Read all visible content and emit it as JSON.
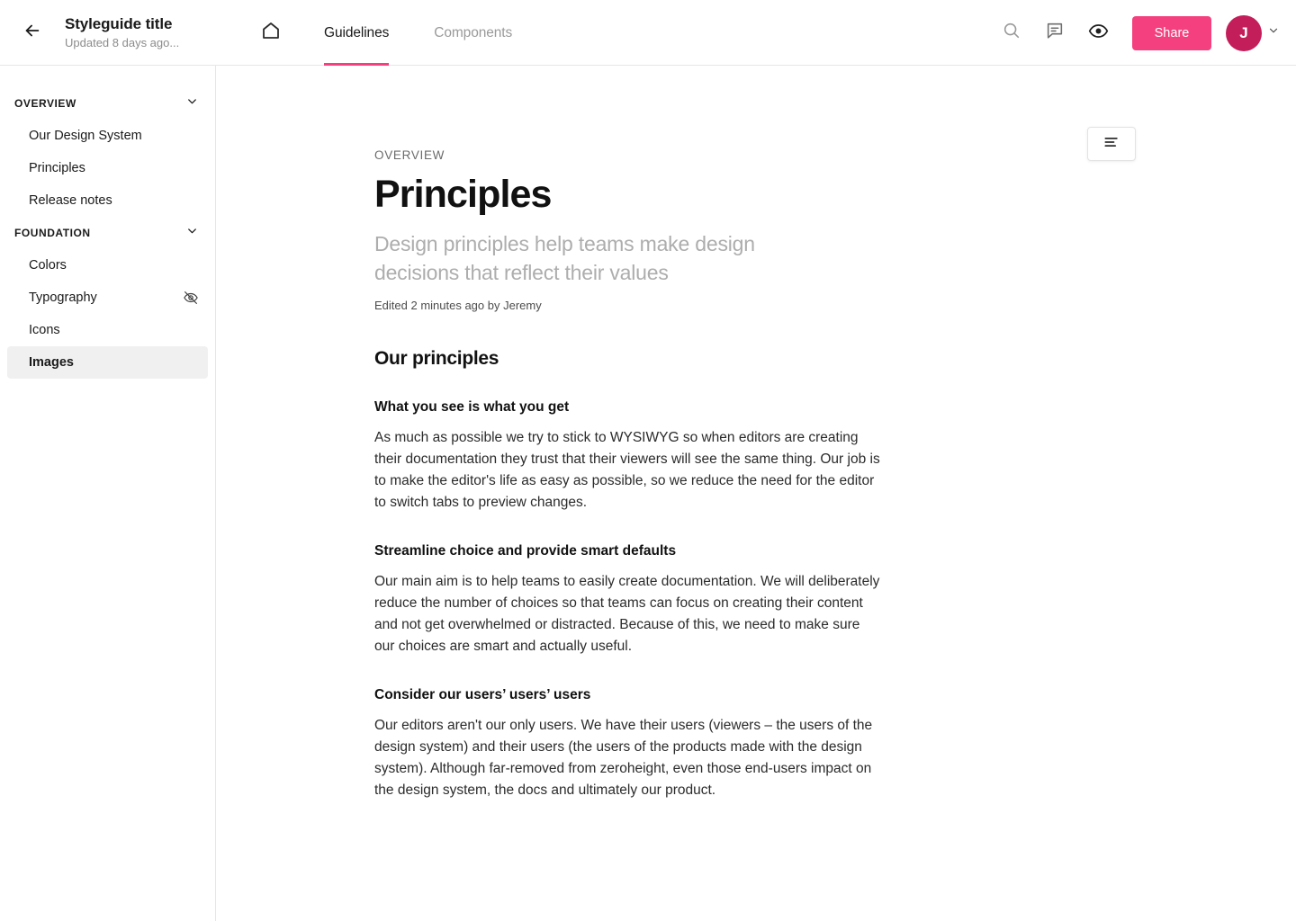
{
  "header": {
    "back_icon": "arrow-left-icon",
    "doc_title": "Styleguide title",
    "doc_subtitle": "Updated 8 days ago...",
    "home_icon": "home-icon",
    "tabs": [
      {
        "label": "Guidelines",
        "active": true
      },
      {
        "label": "Components",
        "active": false
      }
    ],
    "icons": [
      {
        "name": "search-icon"
      },
      {
        "name": "comment-icon"
      },
      {
        "name": "eye-icon"
      }
    ],
    "share_label": "Share",
    "avatar_initial": "J",
    "avatar_chevron_icon": "chevron-down-icon",
    "accent_color": "#f4407e",
    "avatar_color": "#c41e5a"
  },
  "sidebar": {
    "sections": [
      {
        "label": "OVERVIEW",
        "chevron_icon": "chevron-down-icon",
        "items": [
          {
            "label": "Our Design System",
            "active": false,
            "hidden": false
          },
          {
            "label": "Principles",
            "active": false,
            "hidden": false
          },
          {
            "label": "Release notes",
            "active": false,
            "hidden": false
          }
        ]
      },
      {
        "label": "FOUNDATION",
        "chevron_icon": "chevron-down-icon",
        "items": [
          {
            "label": "Colors",
            "active": false,
            "hidden": false
          },
          {
            "label": "Typography",
            "active": false,
            "hidden": true
          },
          {
            "label": "Icons",
            "active": false,
            "hidden": false
          },
          {
            "label": "Images",
            "active": true,
            "hidden": false
          }
        ]
      }
    ]
  },
  "main": {
    "toc_icon": "text-align-icon",
    "eyebrow": "OVERVIEW",
    "title": "Principles",
    "description": "Design principles help teams make design decisions that reflect their values",
    "edited": "Edited 2 minutes ago by Jeremy",
    "section_heading": "Our principles",
    "blocks": [
      {
        "heading": "What you see is what you get",
        "paragraph": "As much as possible we try to stick to WYSIWYG so when editors are creating their documentation they trust that their viewers will see the same thing. Our job is to make the editor's life as easy as possible, so we reduce the need for the editor to switch tabs to preview changes."
      },
      {
        "heading": "Streamline choice and provide smart defaults",
        "paragraph": "Our main aim is to help teams to easily create documentation. We will deliberately reduce the number of choices so that teams can focus on creating their content and not get overwhelmed or distracted. Because of this, we need to make sure our choices are smart and actually useful."
      },
      {
        "heading": "Consider our users’ users’ users",
        "paragraph": "Our editors aren't our only users. We have their users (viewers – the users of the design system) and their users (the users of the products made with the design system). Although far-removed from zeroheight, even those end-users impact on the design system, the docs and ultimately our product."
      }
    ]
  }
}
